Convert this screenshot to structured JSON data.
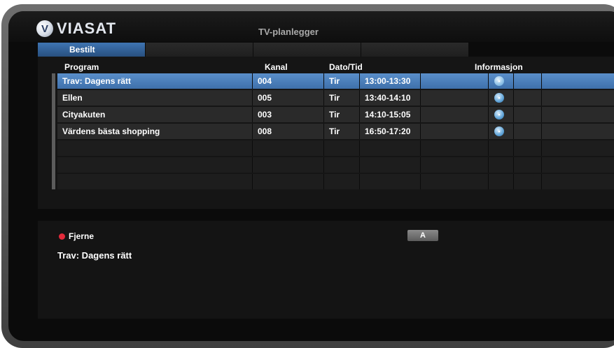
{
  "header": {
    "logo_mark": "V",
    "logo_text": "VIASAT",
    "app_title": "TV-planlegger"
  },
  "tabs": [
    {
      "label": "Bestilt",
      "active": true
    },
    {
      "label": "",
      "active": false
    },
    {
      "label": "",
      "active": false
    },
    {
      "label": "",
      "active": false
    }
  ],
  "columns": {
    "program": "Program",
    "kanal": "Kanal",
    "dato_tid": "Dato/Tid",
    "informasjon": "Informasjon"
  },
  "rows": [
    {
      "program": "Trav: Dagens rätt",
      "kanal": "004",
      "dag": "Tir",
      "tid": "13:00-13:30",
      "info": true,
      "selected": true
    },
    {
      "program": "Ellen",
      "kanal": "005",
      "dag": "Tir",
      "tid": "13:40-14:10",
      "info": true,
      "selected": false
    },
    {
      "program": "Cityakuten",
      "kanal": "003",
      "dag": "Tir",
      "tid": "14:10-15:05",
      "info": true,
      "selected": false
    },
    {
      "program": "Värdens bästa shopping",
      "kanal": "008",
      "dag": "Tir",
      "tid": "16:50-17:20",
      "info": true,
      "selected": false
    }
  ],
  "footer": {
    "action_label": "Fjerne",
    "action_color": "#e22a3a",
    "key_label": "A",
    "selected_program": "Trav: Dagens rätt"
  },
  "colors": {
    "selected_row": "#4a80bf",
    "active_tab": "#3a6aa6",
    "cell": "#2a2a2a"
  },
  "icons": {
    "info": "info-bubble-icon",
    "logo": "viasat-logo-icon"
  }
}
